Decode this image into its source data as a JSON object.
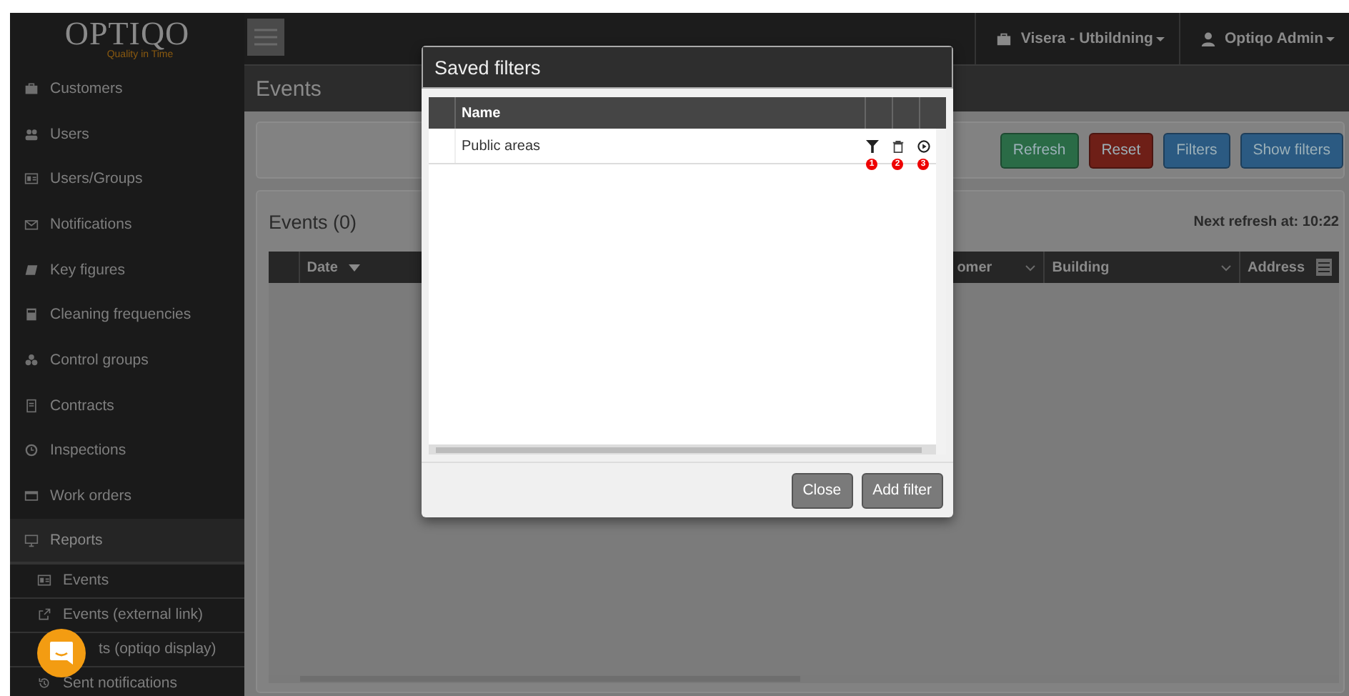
{
  "logo": {
    "wordmark": "OPTIQO",
    "tagline": "Quality in Time"
  },
  "sidebar": {
    "items": [
      {
        "label": "Customers",
        "selected": false
      },
      {
        "label": "Users",
        "selected": false
      },
      {
        "label": "Users/Groups",
        "selected": false
      },
      {
        "label": "Notifications",
        "selected": false
      },
      {
        "label": "Key figures",
        "selected": false
      },
      {
        "label": "Cleaning frequencies",
        "selected": false
      },
      {
        "label": "Control groups",
        "selected": false
      },
      {
        "label": "Contracts",
        "selected": false
      },
      {
        "label": "Inspections",
        "selected": false
      },
      {
        "label": "Work orders",
        "selected": false
      },
      {
        "label": "Reports",
        "selected": true
      }
    ],
    "sub_items": [
      {
        "label": "Events"
      },
      {
        "label": "Events (external link)"
      },
      {
        "label": "ts (optiqo display)"
      },
      {
        "label": "Sent notifications"
      }
    ]
  },
  "top_bar": {
    "account": "Visera - Utbildning",
    "user": "Optiqo Admin"
  },
  "page_title": "Events",
  "toolbar": [
    {
      "label": "Refresh",
      "kind": "success"
    },
    {
      "label": "Reset",
      "kind": "danger"
    },
    {
      "label": "Filters",
      "kind": "primary"
    },
    {
      "label": "Show filters",
      "kind": "primary"
    }
  ],
  "panel": {
    "title": "Events (0)",
    "refresh_note": "Next refresh at: 10:22",
    "columns": [
      {
        "label": "Date",
        "sorted": true
      },
      {
        "label": "omer",
        "sorted": false
      },
      {
        "label": "Building",
        "sorted": false
      },
      {
        "label": "Address",
        "sorted": false
      }
    ]
  },
  "dialog": {
    "title": "Saved filters",
    "columns": [
      "Name"
    ],
    "rows": [
      {
        "name": "Public areas",
        "badges": [
          "1",
          "2",
          "3"
        ]
      }
    ],
    "buttons": [
      "Close",
      "Add filter"
    ]
  }
}
